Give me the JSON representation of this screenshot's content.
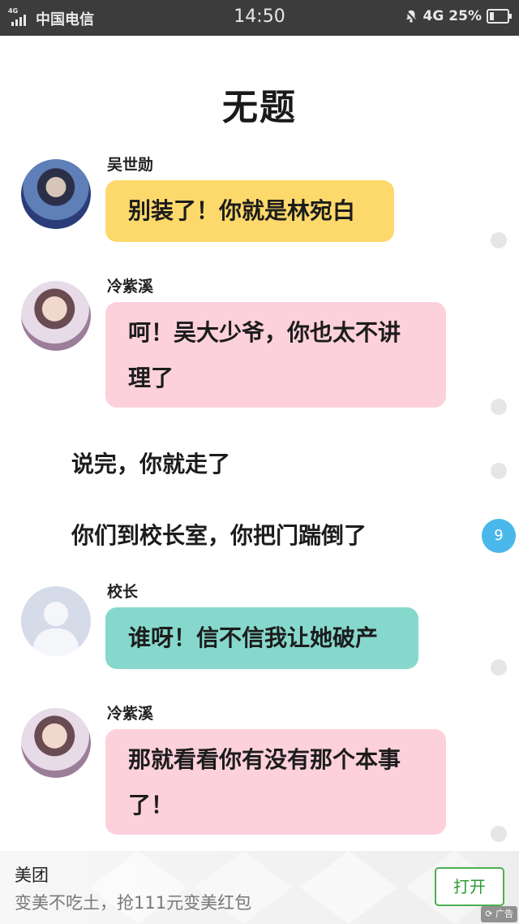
{
  "status_bar": {
    "network_tag": "4G",
    "carrier": "中国电信",
    "time": "14:50",
    "network": "4G",
    "battery": "25%",
    "battery_level": 0.25
  },
  "page": {
    "title": "无题"
  },
  "messages": [
    {
      "sender": "吴世勋",
      "text": "别装了！你就是林宛白"
    },
    {
      "sender": "冷紫溪",
      "line1": "呵！吴大少爷，你也太不讲",
      "line2": "理了"
    },
    {
      "narration": "说完，你就走了"
    },
    {
      "narration": "你们到校长室，你把门踹倒了"
    },
    {
      "sender": "校长",
      "text": "谁呀！信不信我让她破产"
    },
    {
      "sender": "冷紫溪",
      "line1": "那就看看你有没有那个本事",
      "line2": "了！"
    }
  ],
  "comment_badge": {
    "count": "9"
  },
  "ad": {
    "name": "美团",
    "slogan": "变美不吃土，抢111元变美红包",
    "button": "打开",
    "tag": "广告"
  },
  "colors": {
    "yellow_bubble": "#fdd96b",
    "pink_bubble": "#fdd1dc",
    "teal_bubble": "#86d8cc",
    "badge_blue": "#4ab7ea",
    "status_bar": "#3c3c3c"
  }
}
